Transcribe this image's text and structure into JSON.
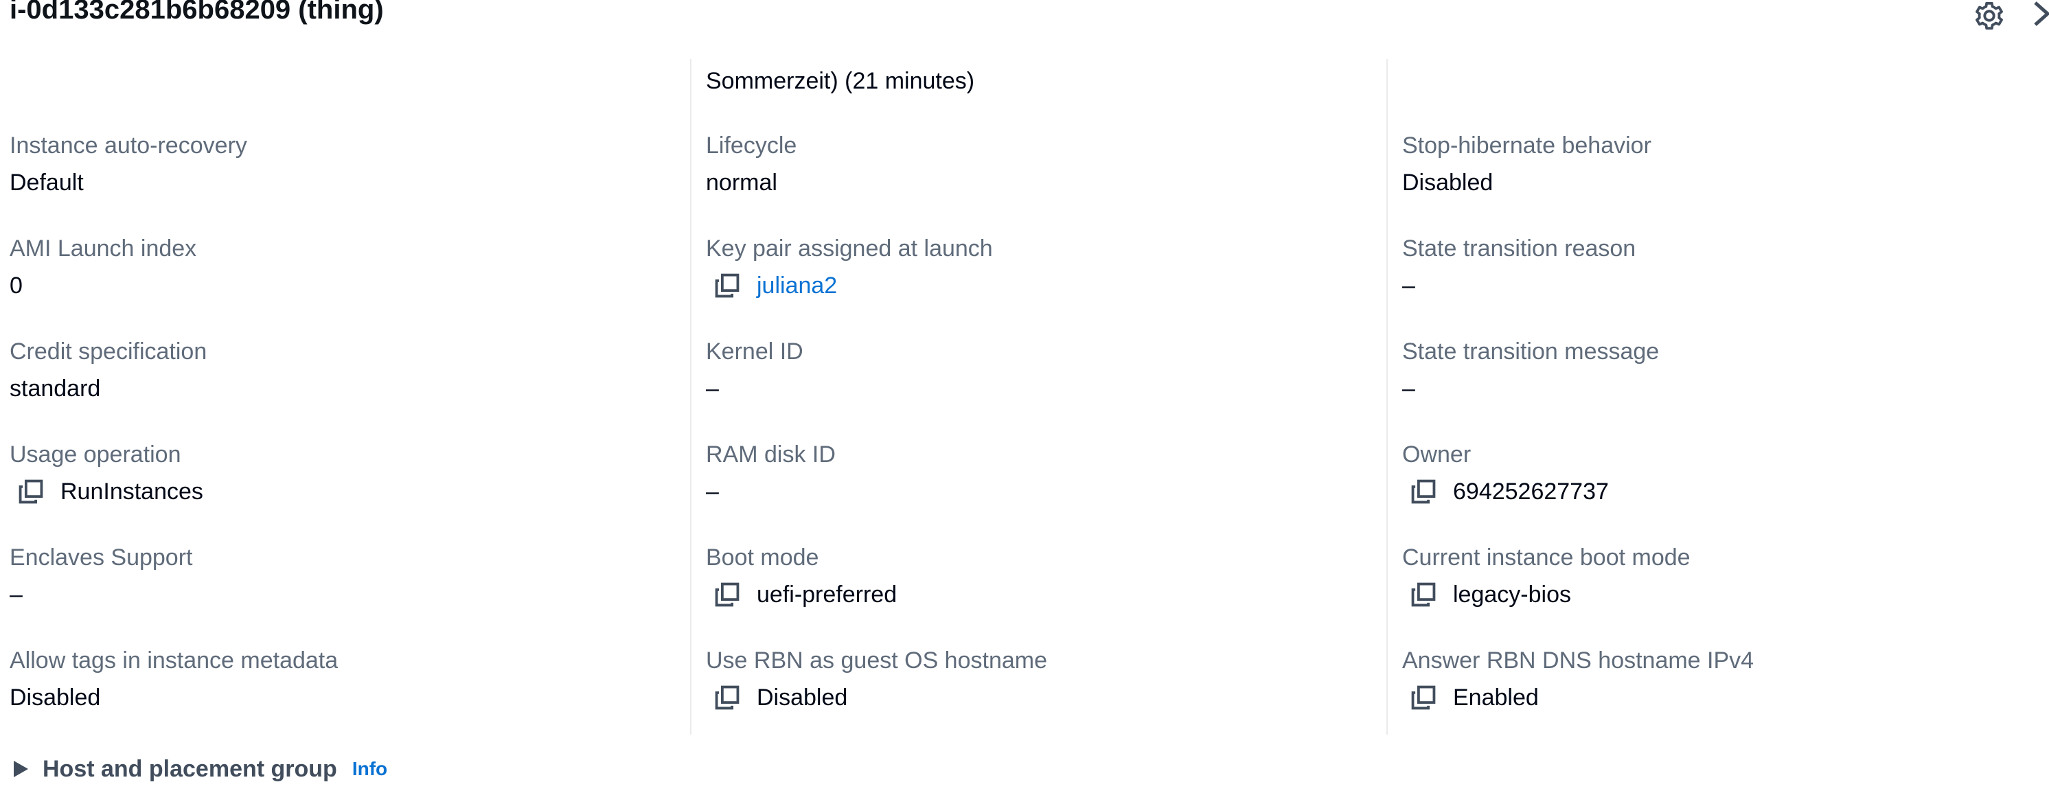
{
  "header": {
    "title": "i-0d133c281b6b68209 (thing)"
  },
  "top_partial_value": "Sommerzeit) (21 minutes)",
  "columns": [
    {
      "fields": [
        {
          "label": "Instance auto-recovery",
          "value": "Default",
          "copy": false,
          "link": false
        },
        {
          "label": "AMI Launch index",
          "value": "0",
          "copy": false,
          "link": false
        },
        {
          "label": "Credit specification",
          "value": "standard",
          "copy": false,
          "link": false
        },
        {
          "label": "Usage operation",
          "value": "RunInstances",
          "copy": true,
          "link": false
        },
        {
          "label": "Enclaves Support",
          "value": "–",
          "copy": false,
          "link": false
        },
        {
          "label": "Allow tags in instance metadata",
          "value": "Disabled",
          "copy": false,
          "link": false
        }
      ]
    },
    {
      "fields": [
        {
          "label": "Lifecycle",
          "value": "normal",
          "copy": false,
          "link": false
        },
        {
          "label": "Key pair assigned at launch",
          "value": "juliana2",
          "copy": true,
          "link": true
        },
        {
          "label": "Kernel ID",
          "value": "–",
          "copy": false,
          "link": false
        },
        {
          "label": "RAM disk ID",
          "value": "–",
          "copy": false,
          "link": false
        },
        {
          "label": "Boot mode",
          "value": "uefi-preferred",
          "copy": true,
          "link": false
        },
        {
          "label": "Use RBN as guest OS hostname",
          "value": "Disabled",
          "copy": true,
          "link": false
        }
      ]
    },
    {
      "fields": [
        {
          "label": "Stop-hibernate behavior",
          "value": "Disabled",
          "copy": false,
          "link": false
        },
        {
          "label": "State transition reason",
          "value": "–",
          "copy": false,
          "link": false
        },
        {
          "label": "State transition message",
          "value": "–",
          "copy": false,
          "link": false
        },
        {
          "label": "Owner",
          "value": "694252627737",
          "copy": true,
          "link": false
        },
        {
          "label": "Current instance boot mode",
          "value": "legacy-bios",
          "copy": true,
          "link": false
        },
        {
          "label": "Answer RBN DNS hostname IPv4",
          "value": "Enabled",
          "copy": true,
          "link": false
        }
      ]
    }
  ],
  "host_group": {
    "title": "Host and placement group",
    "info": "Info"
  },
  "icons": {
    "settings": "gear-icon",
    "next": "chevron-right-icon",
    "copy": "copy-icon",
    "expand": "caret-right-icon"
  },
  "colors": {
    "label": "#5f6b7a",
    "value": "#000716",
    "link": "#0972d3",
    "divider": "#e9ebed"
  }
}
